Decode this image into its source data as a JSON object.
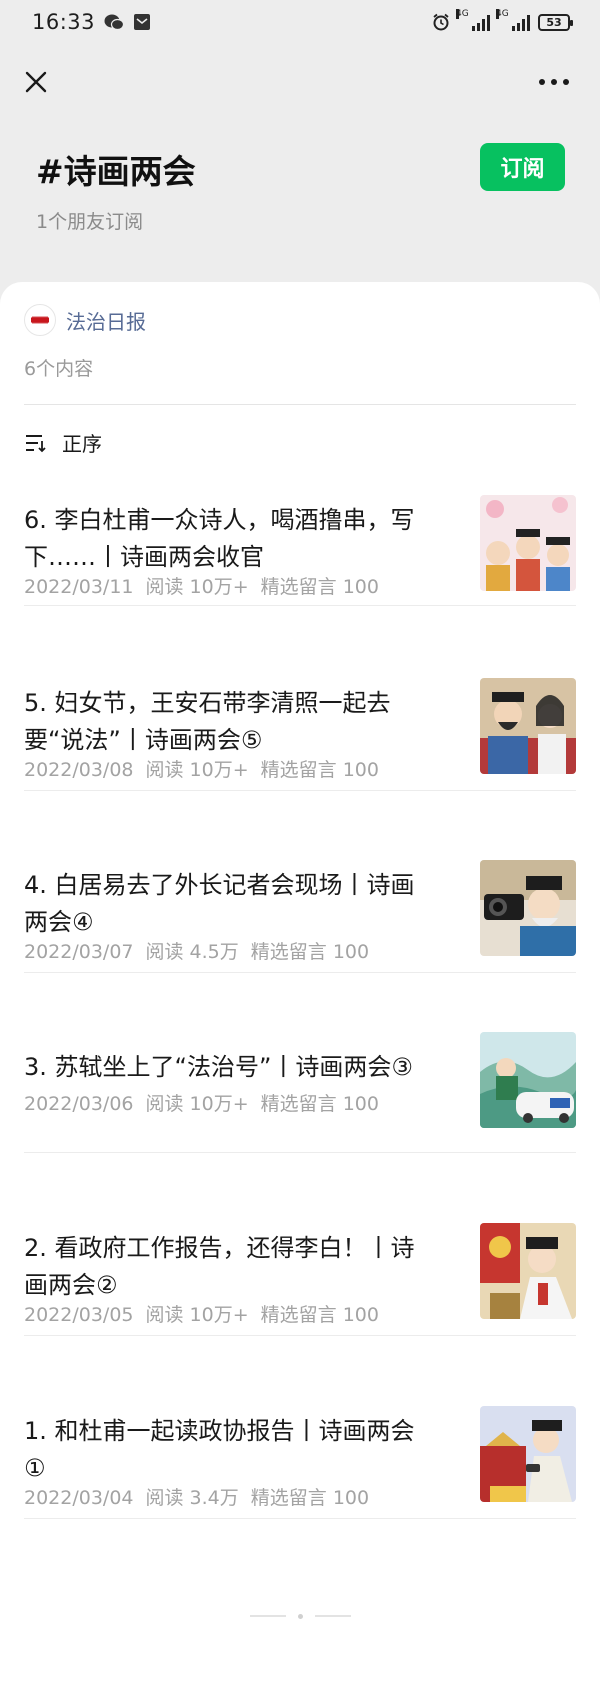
{
  "status_bar": {
    "time": "16:33",
    "battery": "53",
    "network_tag": "4G"
  },
  "topic": {
    "title": "#诗画两会",
    "subscriber_text": "1个朋友订阅",
    "subscribe_label": "订阅"
  },
  "account": {
    "name": "法治日报",
    "content_count": "6个内容"
  },
  "sort": {
    "label": "正序"
  },
  "articles": [
    {
      "title": "6. 李白杜甫一众诗人，喝酒撸串，写下……丨诗画两会收官",
      "date": "2022/03/11",
      "reads": "阅读 10万+",
      "comments": "精选留言 100"
    },
    {
      "title": "5. 妇女节，王安石带李清照一起去要“说法”丨诗画两会⑤",
      "date": "2022/03/08",
      "reads": "阅读 10万+",
      "comments": "精选留言 100"
    },
    {
      "title": "4. 白居易去了外长记者会现场丨诗画两会④",
      "date": "2022/03/07",
      "reads": "阅读 4.5万",
      "comments": "精选留言 100"
    },
    {
      "title": "3. 苏轼坐上了“法治号”丨诗画两会③",
      "date": "2022/03/06",
      "reads": "阅读 10万+",
      "comments": "精选留言 100"
    },
    {
      "title": "2. 看政府工作报告，还得李白！丨诗画两会②",
      "date": "2022/03/05",
      "reads": "阅读 10万+",
      "comments": "精选留言 100"
    },
    {
      "title": "1. 和杜甫一起读政协报告丨诗画两会①",
      "date": "2022/03/04",
      "reads": "阅读 3.4万",
      "comments": "精选留言 100"
    }
  ],
  "colors": {
    "accent": "#07c160",
    "account_link": "#576b95",
    "meta": "#a3a3a3"
  }
}
